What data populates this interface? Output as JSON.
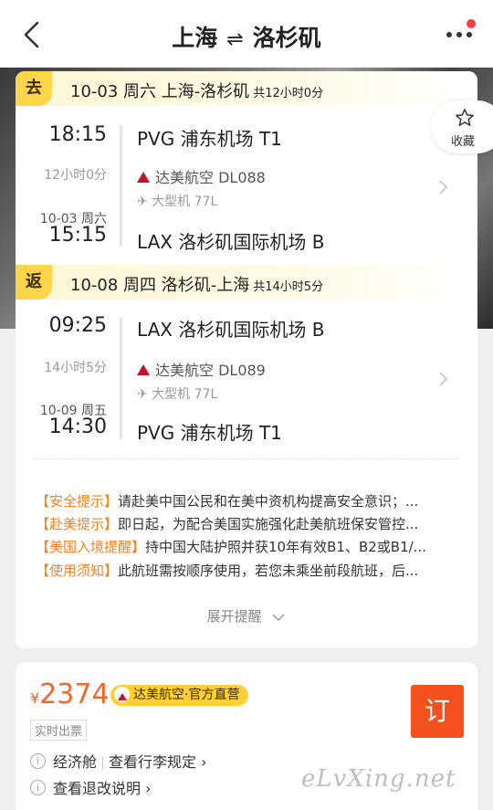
{
  "header": {
    "from": "上海",
    "to": "洛杉矶",
    "arrows": "⇌"
  },
  "favorite": {
    "label": "收藏"
  },
  "outbound": {
    "tag": "去",
    "summary": "10-03 周六 上海-洛杉矶",
    "total_duration": "共12小时0分",
    "dep_time": "18:15",
    "flight_duration": "12小时0分",
    "arr_date": "10-03 周六",
    "arr_time": "15:15",
    "dep_airport": "PVG 浦东机场 T1",
    "airline": "达美航空 DL088",
    "aircraft": "大型机 77L",
    "arr_airport": "LAX 洛杉矶国际机场 B"
  },
  "return": {
    "tag": "返",
    "summary": "10-08 周四 洛杉矶-上海",
    "total_duration": "共14小时5分",
    "dep_time": "09:25",
    "flight_duration": "14小时5分",
    "arr_date": "10-09 周五",
    "arr_time": "14:30",
    "dep_airport": "LAX 洛杉矶国际机场 B",
    "airline": "达美航空 DL089",
    "aircraft": "大型机 77L",
    "arr_airport": "PVG 浦东机场 T1"
  },
  "tips": [
    {
      "key": "【安全提示】",
      "text": "请赴美中国公民和在美中资机构提高安全意识；..."
    },
    {
      "key": "【赴美提示】",
      "text": "即日起，为配合美国实施强化赴美航班保安管控..."
    },
    {
      "key": "【美国入境提醒】",
      "text": "持中国大陆护照并获10年有效B1、B2或B1/..."
    },
    {
      "key": "【使用须知】",
      "text": "此航班需按顺序使用，若您未乘坐前段航班，后..."
    }
  ],
  "expand_label": "展开提醒",
  "offer": {
    "currency": "¥",
    "price": "2374",
    "badge": "达美航空·官方直营",
    "realtime": "实时出票",
    "cabin": "经济舱",
    "baggage_link": "查看行李规定",
    "refund_link": "查看退改说明",
    "book_label": "订"
  },
  "watermark": "eLvXing.net",
  "colors": {
    "accent": "#f0692c",
    "tip_key": "#f58220",
    "tag_yellow": "#fbd54a",
    "book_button": "#f4511e",
    "delta_red": "#c8102e"
  }
}
